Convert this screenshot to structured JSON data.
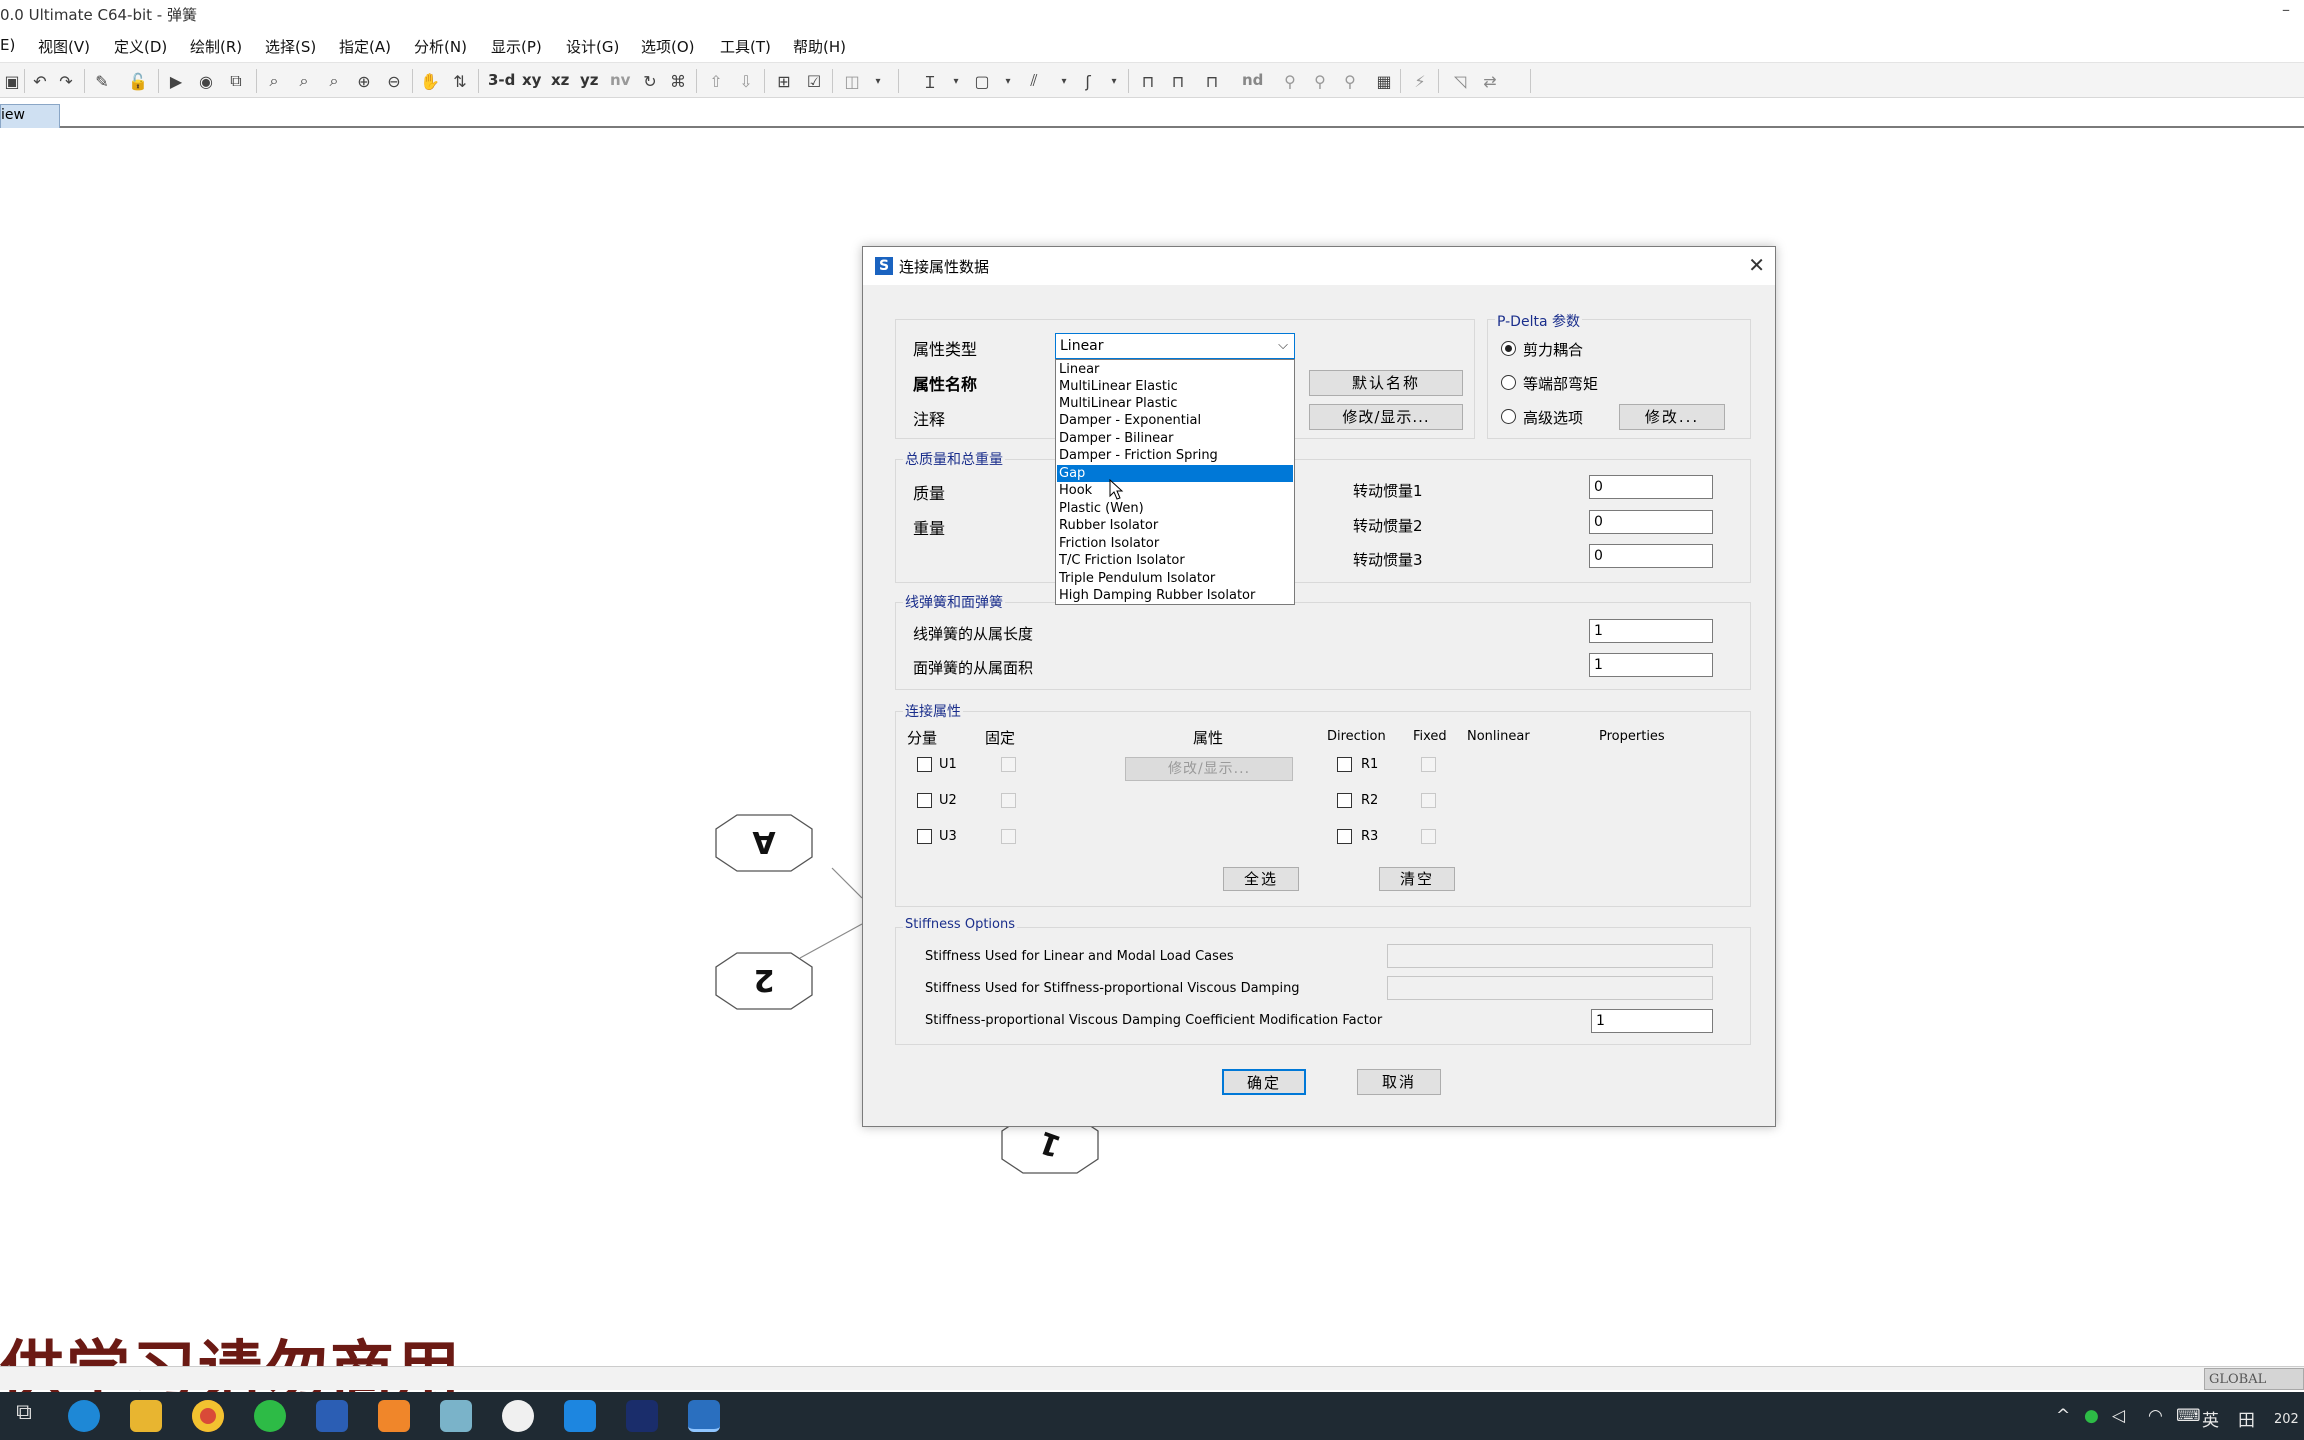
{
  "window": {
    "title": "0.0 Ultimate C64-bit - 弹簧",
    "minimize": "–"
  },
  "menu": [
    "E)",
    "视图(V)",
    "定义(D)",
    "绘制(R)",
    "选择(S)",
    "指定(A)",
    "分析(N)",
    "显示(P)",
    "设计(G)",
    "选项(O)",
    "工具(T)",
    "帮助(H)"
  ],
  "toolbar": {
    "t3d": "3-d",
    "txy": "xy",
    "txz": "xz",
    "tyz": "yz",
    "tnv": "nv",
    "tnd": "nd"
  },
  "view_tab": "iew",
  "grid_bubbles": {
    "a": "A",
    "b": "2",
    "c": "1"
  },
  "watermark": "供学习请勿商用",
  "status": {
    "global": "GLOBAL"
  },
  "tray": {
    "ime": "英",
    "grid": "田",
    "clock": "202"
  },
  "dialog": {
    "title": "连接属性数据",
    "close": "✕",
    "prop_type_label": "属性类型",
    "prop_name_label": "属性名称",
    "note_label": "注释",
    "combo_value": "Linear",
    "combo_arrow": "⌵",
    "options": [
      "Linear",
      "MultiLinear Elastic",
      "MultiLinear Plastic",
      "Damper - Exponential",
      "Damper - Bilinear",
      "Damper - Friction Spring",
      "Gap",
      "Hook",
      "Plastic (Wen)",
      "Rubber Isolator",
      "Friction Isolator",
      "T/C Friction Isolator",
      "Triple Pendulum Isolator",
      "High Damping Rubber Isolator"
    ],
    "selected_option": "Gap",
    "default_name_btn": "默认名称",
    "modify_show_btn": "修改/显示...",
    "pdelta": {
      "title": "P-Delta 参数",
      "opt1": "剪力耦合",
      "opt2": "等端部弯矩",
      "opt3": "高级选项",
      "modify_btn": "修改..."
    },
    "mass": {
      "title": "总质量和总重量",
      "mass_label": "质量",
      "weight_label": "重量",
      "rot1_label": "转动惯量1",
      "rot2_label": "转动惯量2",
      "rot3_label": "转动惯量3",
      "rot1": "0",
      "rot2": "0",
      "rot3": "0"
    },
    "spring": {
      "title": "线弹簧和面弹簧",
      "line_label": "线弹簧的从属长度",
      "area_label": "面弹簧的从属面积",
      "line_val": "1",
      "area_val": "1"
    },
    "link": {
      "title": "连接属性",
      "h_comp": "分量",
      "h_fixed": "固定",
      "h_prop": "属性",
      "h_dir": "Direction",
      "h_fixed2": "Fixed",
      "h_nonlinear": "Nonlinear",
      "h_props": "Properties",
      "u1": "U1",
      "u2": "U2",
      "u3": "U3",
      "r1": "R1",
      "r2": "R2",
      "r3": "R3",
      "modify_btn": "修改/显示...",
      "select_all": "全选",
      "clear": "清空"
    },
    "stiffness": {
      "title": "Stiffness Options",
      "row1": "Stiffness Used for Linear and Modal Load Cases",
      "row2": "Stiffness Used for Stiffness-proportional Viscous Damping",
      "row3": "Stiffness-proportional Viscous Damping Coefficient Modification Factor",
      "factor": "1"
    },
    "ok": "确定",
    "cancel": "取消"
  }
}
